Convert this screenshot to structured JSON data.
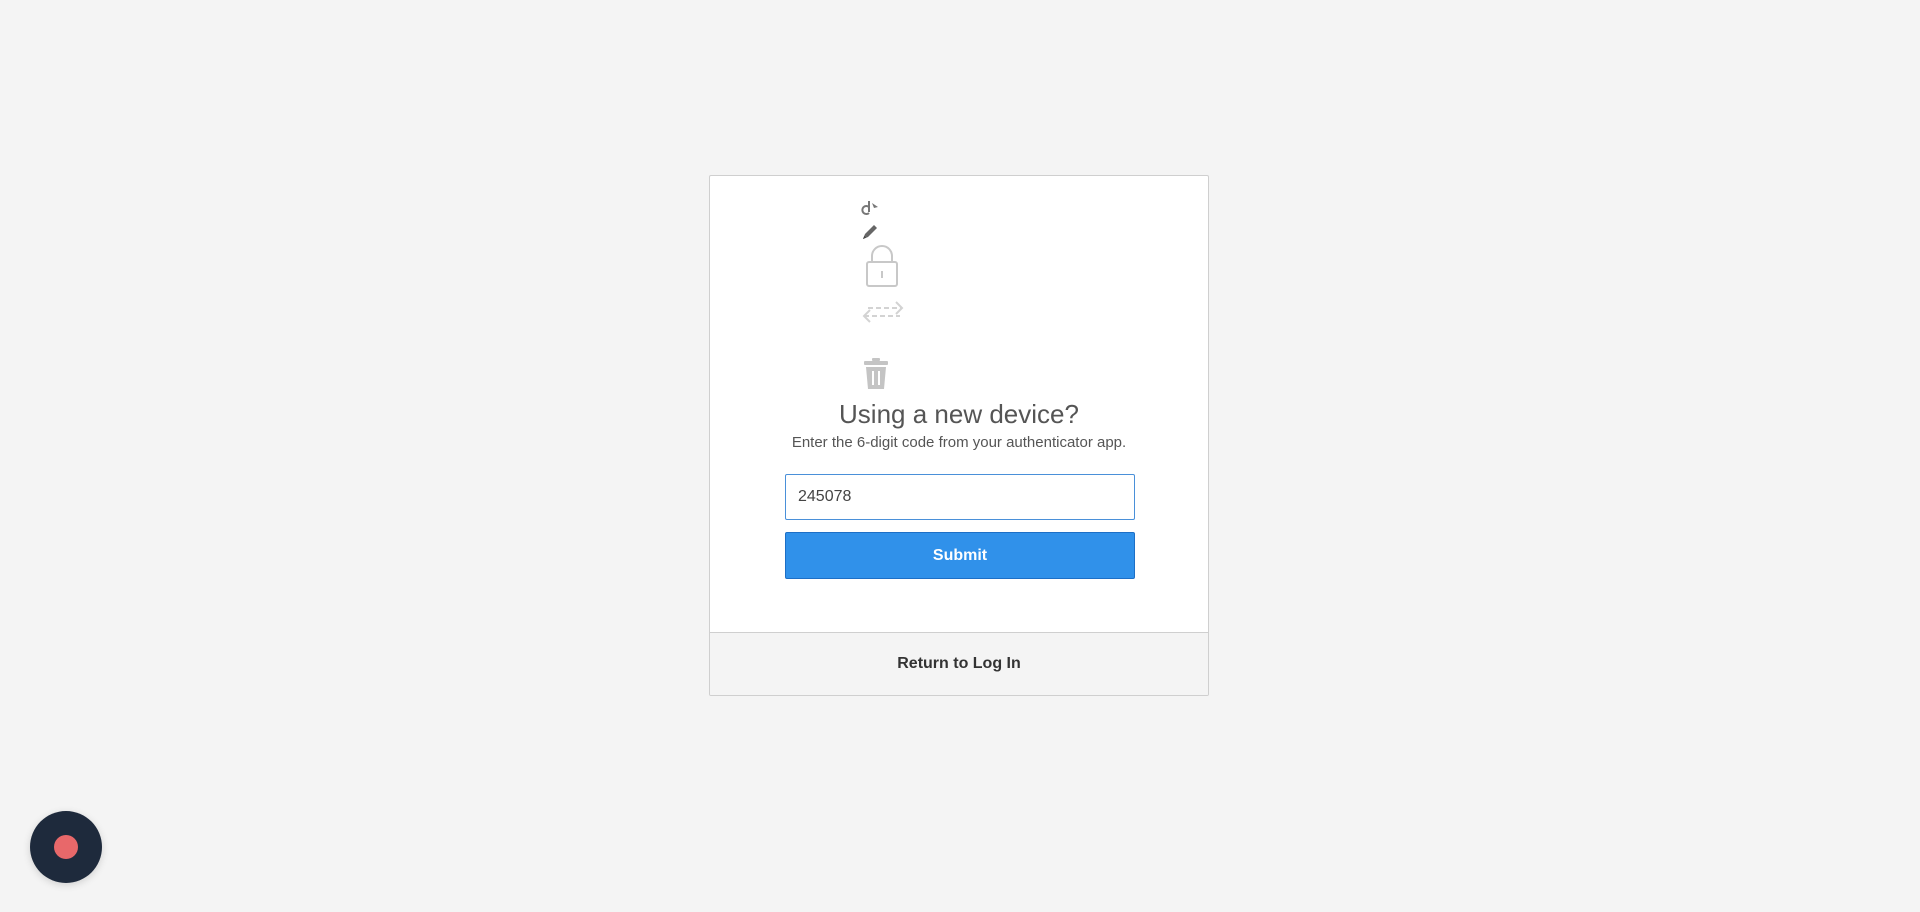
{
  "form": {
    "title": "Using a new device?",
    "subtitle": "Enter the 6-digit code from your authenticator app.",
    "code_value": "245078",
    "submit_label": "Submit"
  },
  "footer": {
    "return_label": "Return to Log In"
  },
  "icons": [
    "pointer-icon",
    "pencil-icon",
    "lock-icon",
    "transfer-icon",
    "trash-icon"
  ],
  "colors": {
    "background": "#f4f4f4",
    "card": "#ffffff",
    "primary_button": "#3091ea",
    "input_border": "#4a90d9",
    "recorder_bg": "#1e2a3c",
    "recorder_dot": "#e8686a"
  }
}
